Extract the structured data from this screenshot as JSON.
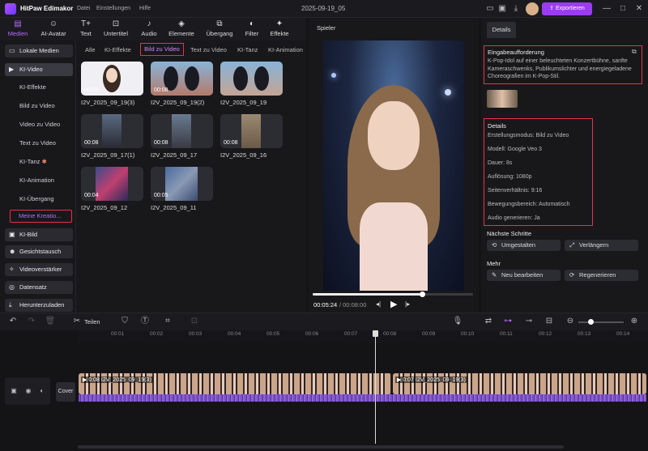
{
  "app": {
    "name": "HitPaw Edimakor",
    "menu": [
      "Datei",
      "Einstellungen",
      "Hilfe"
    ],
    "document_title": "2025-09-19_05",
    "export_label": "Exportieren"
  },
  "toolbar": [
    {
      "label": "Medien",
      "icon": "media-icon"
    },
    {
      "label": "AI-Avatar",
      "icon": "avatar-icon"
    },
    {
      "label": "Text",
      "icon": "text-icon"
    },
    {
      "label": "Untertitel",
      "icon": "subtitle-icon"
    },
    {
      "label": "Audio",
      "icon": "music-icon"
    },
    {
      "label": "Elemente",
      "icon": "elements-icon"
    },
    {
      "label": "Übergang",
      "icon": "transition-icon"
    },
    {
      "label": "Filter",
      "icon": "filter-icon"
    },
    {
      "label": "Effekte",
      "icon": "effects-icon"
    }
  ],
  "sidebar": {
    "local": "Lokale Medien",
    "ki_video": "KI-Video",
    "sub": [
      "KI-Effekte",
      "Bild zu Video",
      "Video zu Video",
      "Text zu Video",
      "KI-Tanz",
      "KI-Animation",
      "KI-Übergang"
    ],
    "selected": "Meine Kreatio...",
    "bottom": [
      "KI-Bild",
      "Gesichtstausch",
      "Videoverstärker",
      "Datensatz",
      "Herunterzuladen"
    ]
  },
  "media_tabs": [
    "Alle",
    "KI-Effekte",
    "Bild zu Video",
    "Text zu Video",
    "KI-Tanz",
    "KI-Animation"
  ],
  "media_items": [
    {
      "name": "I2V_2025_09_19(3)",
      "duration": "00:08"
    },
    {
      "name": "I2V_2025_09_19(2)",
      "duration": "00:08"
    },
    {
      "name": "I2V_2025_09_19",
      "duration": ""
    },
    {
      "name": "I2V_2025_09_17(1)",
      "duration": "00:08"
    },
    {
      "name": "I2V_2025_09_17",
      "duration": "00:08"
    },
    {
      "name": "I2V_2025_09_16",
      "duration": "00:08"
    },
    {
      "name": "I2V_2025_09_12",
      "duration": "00:04"
    },
    {
      "name": "I2V_2025_09_11",
      "duration": "00:05"
    }
  ],
  "player": {
    "header": "Spieler",
    "current_time": "00:05:24",
    "total_time": "/ 00:08:00",
    "progress": 0.68
  },
  "details": {
    "tab": "Details",
    "prompt_title": "Eingabeaufforderung",
    "prompt_text": "K-Pop-Idol auf einer beleuchteten Konzertbühne, sanfte Kameraschwenks, Publikumslichter und energiegeladene Choreografien im K-Pop-Stil.",
    "details_title": "Details",
    "rows": [
      "Erstellungsmodus: Bild zu Video",
      "Modell: Google Veo 3",
      "Dauer: 8s",
      "Auflösung: 1080p",
      "Seitenverhältnis: 9:16",
      "Bewegungsbereich: Automatisch",
      "Audio generieren: Ja"
    ],
    "next_title": "Nächste Schritte",
    "next_buttons": [
      "Umgestalten",
      "Verlängern"
    ],
    "more_title": "Mehr",
    "more_buttons": [
      "Neu bearbeiten",
      "Regenerieren"
    ]
  },
  "timeline": {
    "split_label": "Teilen",
    "ruler": [
      "00:01",
      "00:02",
      "00:03",
      "00:04",
      "00:05",
      "00:06",
      "00:07",
      "00:08",
      "00:09",
      "00:10",
      "00:11",
      "00:12",
      "00:13",
      "00:14"
    ],
    "cover_label": "Cover",
    "clip1": "0:08 I2V_2025_09_19(3)",
    "clip2": "0:07 I2V_2025_09_19(3)"
  },
  "colors": {
    "accent": "#9b3cf0",
    "highlight": "#e5324a",
    "audio": "#7b4fc9"
  }
}
